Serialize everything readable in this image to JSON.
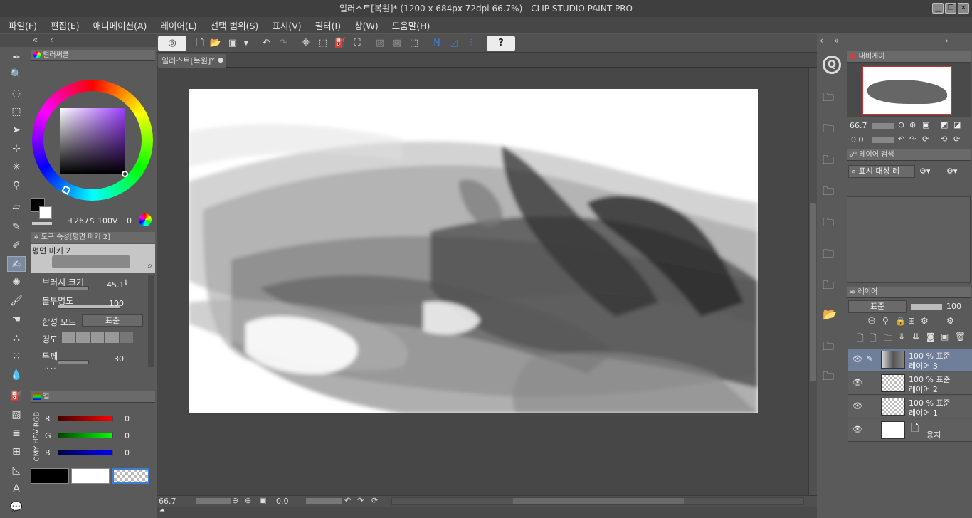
{
  "window": {
    "title": "일러스트[복원]* (1200 x 684px 72dpi 66.7%)  - CLIP STUDIO PAINT PRO",
    "minimize": "▁",
    "maximize": "❐",
    "close": "✕"
  },
  "menu": [
    "파일(F)",
    "편집(E)",
    "애니메이션(A)",
    "레이어(L)",
    "선택 범위(S)",
    "표시(V)",
    "필터(I)",
    "창(W)",
    "도움말(H)"
  ],
  "document": {
    "tab_label": "일러스트[복원]*"
  },
  "color_wheel": {
    "tab": "컬러써클",
    "h_label": "H",
    "h": "267",
    "s_label": "S",
    "s": "100",
    "v_label": "V",
    "v": "0",
    "fg_color": "#000000",
    "bg_color": "#ffffff"
  },
  "tool_property": {
    "tab": "도구 속성[평면 마커 2]",
    "brush_name": "평면 마커 2",
    "brush_size_label": "브러시 크기",
    "brush_size": "45.1",
    "opacity_label": "불투명도",
    "opacity": "100",
    "blend_label": "합성 모드",
    "blend_value": "표준",
    "hardness_label": "경도",
    "thickness_label": "두께",
    "thickness": "30",
    "direction_label": "방향"
  },
  "color_slider": {
    "tab": "컬",
    "side_labels": [
      "RGB",
      "HSV",
      "CMY"
    ],
    "r_label": "R",
    "r": "0",
    "g_label": "G",
    "g": "0",
    "b_label": "B",
    "b": "0"
  },
  "status": {
    "zoom": "66.7",
    "angle": "0.0"
  },
  "navigator": {
    "tab": "내비게이",
    "zoom": "66.7",
    "angle": "0.0"
  },
  "layer_search": {
    "tab": "레이어 검색",
    "filter": "표시 대상 레"
  },
  "layer_panel": {
    "tab": "레이어",
    "blend": "표준",
    "opacity": "100",
    "layers": [
      {
        "percent": "100 % 표준",
        "name": "레이어 3"
      },
      {
        "percent": "100 % 표준",
        "name": "레이어 2"
      },
      {
        "percent": "100 % 표준",
        "name": "레이어 1"
      },
      {
        "percent": "",
        "name": "용지"
      }
    ]
  },
  "colors": {
    "accent": "#6f7f99",
    "selected_blue": "#3d7fd6"
  }
}
